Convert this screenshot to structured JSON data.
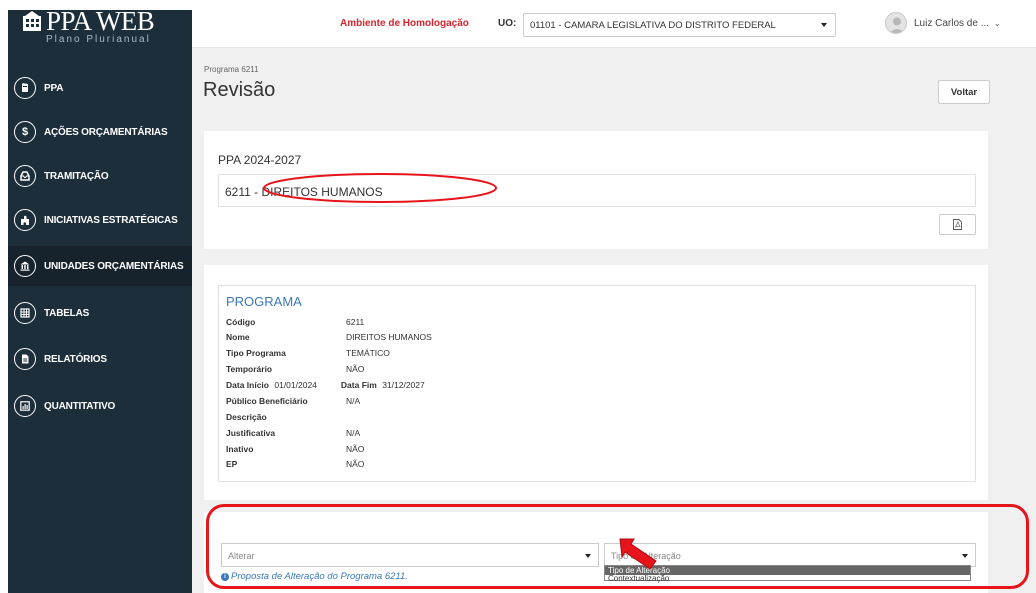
{
  "app": {
    "logo_title": "PPA WEB",
    "logo_subtitle": "Plano Plurianual"
  },
  "sidebar": {
    "items": [
      {
        "label": "PPA",
        "icon": "book-icon"
      },
      {
        "label": "AÇÕES ORÇAMENTÁRIAS",
        "icon": "dollar-icon"
      },
      {
        "label": "TRAMITAÇÃO",
        "icon": "inbox-icon"
      },
      {
        "label": "INICIATIVAS ESTRATÉGICAS",
        "icon": "puzzle-icon"
      },
      {
        "label": "UNIDADES ORÇAMENTÁRIAS",
        "icon": "bank-icon"
      },
      {
        "label": "TABELAS",
        "icon": "table-icon"
      },
      {
        "label": "RELATÓRIOS",
        "icon": "report-icon"
      },
      {
        "label": "QUANTITATIVO",
        "icon": "chart-icon"
      }
    ]
  },
  "header": {
    "environment": "Ambiente de Homologação",
    "uo_label": "UO:",
    "uo_value": "01101 - CAMARA LEGISLATIVA DO DISTRITO FEDERAL",
    "user_name": "Luiz Carlos de ..."
  },
  "page": {
    "breadcrumb": "Programa 6211",
    "title": "Revisão",
    "back_label": "Voltar"
  },
  "summary": {
    "ppa_label": "PPA 2024-2027",
    "program": "6211 - DIREITOS HUMANOS"
  },
  "program_card": {
    "title": "PROGRAMA",
    "fields": {
      "codigo_k": "Código",
      "codigo_v": "6211",
      "nome_k": "Nome",
      "nome_v": "DIREITOS HUMANOS",
      "tipo_k": "Tipo Programa",
      "tipo_v": "TEMÁTICO",
      "temp_k": "Temporário",
      "temp_v": "NÃO",
      "dini_k": "Data Início",
      "dini_v": "01/01/2024",
      "dfim_k": "Data Fim",
      "dfim_v": "31/12/2027",
      "pub_k": "Público Beneficiário",
      "pub_v": "N/A",
      "desc_k": "Descrição",
      "just_k": "Justificativa",
      "just_v": "N/A",
      "inat_k": "Inativo",
      "inat_v": "NÃO",
      "ep_k": "EP",
      "ep_v": "NÃO"
    }
  },
  "alteration": {
    "alterar_placeholder": "Alterar",
    "tipo_placeholder": "Tipo de Alteração",
    "hint": "Proposta de Alteração do Programa 6211.",
    "dropdown_options": [
      "Tipo de Alteração",
      "Contextualização"
    ]
  },
  "colors": {
    "sidebar_bg": "#1d2e3b",
    "env_red": "#d9232e",
    "link_blue": "#3a7ab8",
    "annotation_red": "#e8141c"
  }
}
